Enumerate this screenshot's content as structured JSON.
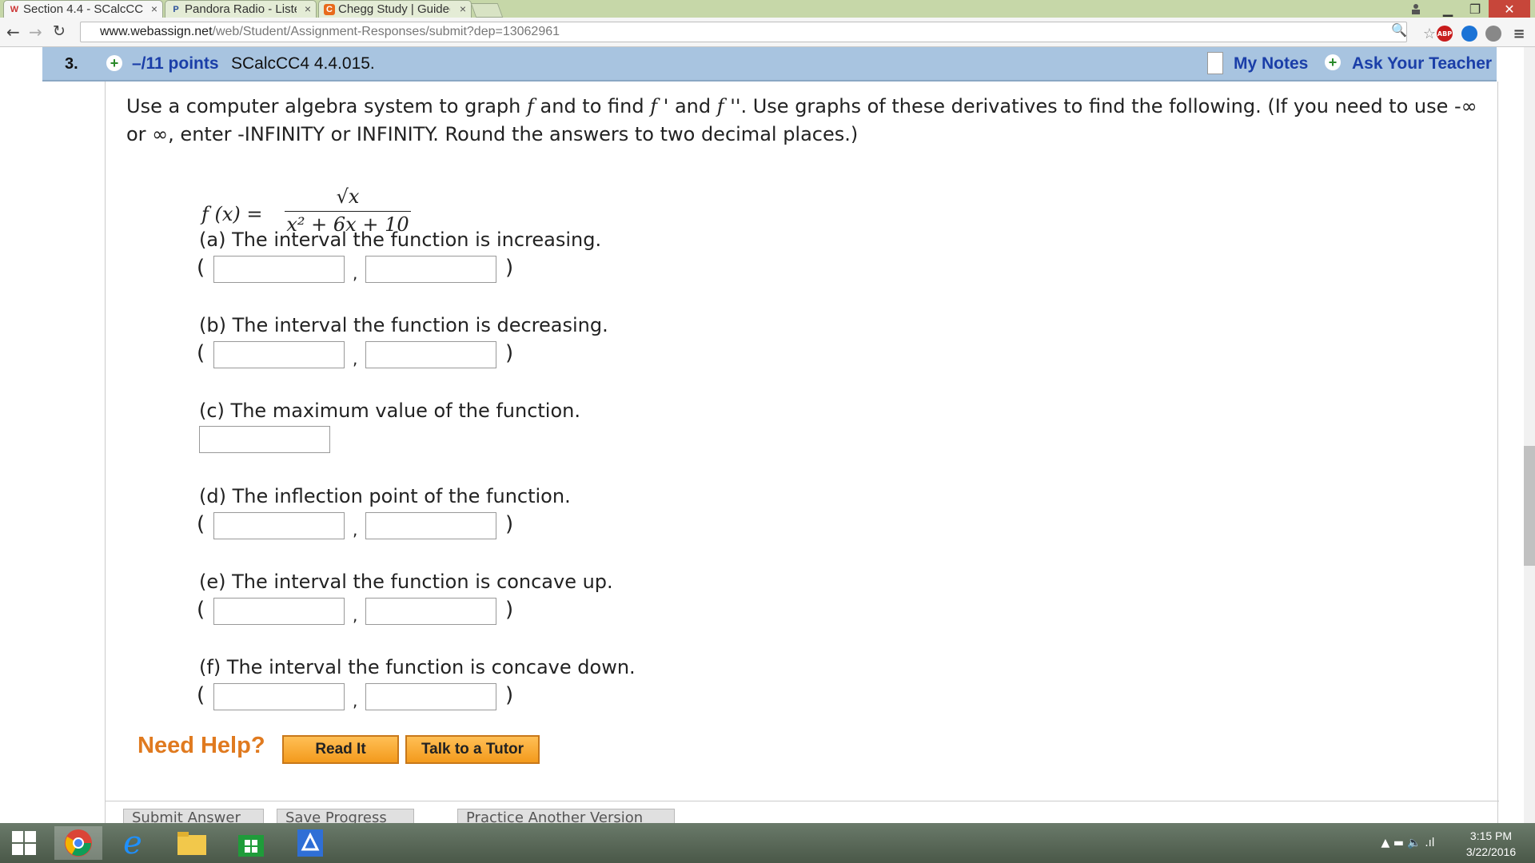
{
  "browser": {
    "tabs": [
      {
        "label": "Section 4.4 - SCalcCC",
        "favicon": "W",
        "active": true
      },
      {
        "label": "Pandora Radio - Listen",
        "favicon": "P",
        "active": false
      },
      {
        "label": "Chegg Study | Guided",
        "favicon": "C",
        "active": false
      }
    ],
    "url_host": "www.webassign.net",
    "url_path": "/web/Student/Assignment-Responses/submit?dep=13062961",
    "extensions": [
      "ABP"
    ]
  },
  "question": {
    "number": "3.",
    "points": "–/11 points",
    "id": "SCalcCC4 4.4.015.",
    "my_notes": "My Notes",
    "ask_teacher": "Ask Your Teacher"
  },
  "instructions": {
    "p1": "Use a computer algebra system to graph ",
    "f": "f",
    "p2": " and to find ",
    "f1": "f",
    "p3": " ' and ",
    "f2": "f",
    "p4": " ''. Use graphs of these derivatives to find the following. (If you need to use -∞ or ∞, enter -INFINITY or INFINITY. Round the answers to two decimal places.)"
  },
  "formula": {
    "lhs": "f (x) =",
    "numerator": "√x",
    "denominator": "x² + 6x + 10"
  },
  "parts": {
    "a": "(a) The interval the function is increasing.",
    "b": "(b) The interval the function is decreasing.",
    "c": "(c) The maximum value of the function.",
    "d": "(d) The inflection point of the function.",
    "e": "(e) The interval the function is concave up.",
    "f": "(f) The interval the function is concave down."
  },
  "symbols": {
    "open": "(",
    "close": ")",
    "comma": ","
  },
  "help": {
    "label": "Need Help?",
    "read_it": "Read It",
    "tutor": "Talk to a Tutor"
  },
  "bottom_buttons": [
    "Submit Answer",
    "Save Progress",
    "Practice Another Version"
  ],
  "taskbar": {
    "time": "3:15 PM",
    "date": "3/22/2016"
  },
  "colors": {
    "question_bar": "#a8c4e0",
    "link_blue": "#1a3ea8",
    "help_orange": "#e07a1f"
  }
}
